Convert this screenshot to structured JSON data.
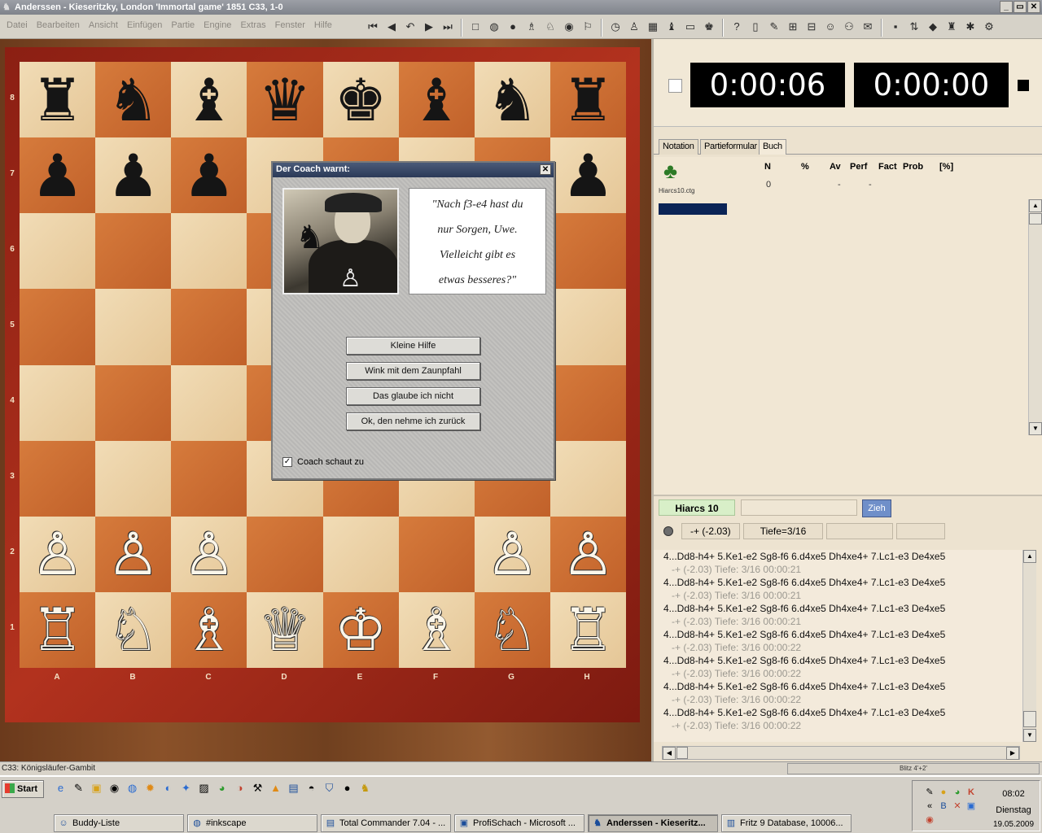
{
  "window": {
    "title": "Anderssen - Kieseritzky, London 'Immortal game' 1851  C33, 1-0",
    "buttons": [
      "_",
      "▭",
      "✕"
    ]
  },
  "menu": [
    "Datei",
    "Bearbeiten",
    "Ansicht",
    "Einfügen",
    "Partie",
    "Engine",
    "Extras",
    "Fenster",
    "Hilfe"
  ],
  "board": {
    "files": [
      "A",
      "B",
      "C",
      "D",
      "E",
      "F",
      "G",
      "H"
    ],
    "ranks": [
      "8",
      "7",
      "6",
      "5",
      "4",
      "3",
      "2",
      "1"
    ],
    "rows": [
      [
        "♜",
        "♞",
        "♝",
        "♛",
        "♚",
        "♝",
        "♞",
        "♜"
      ],
      [
        "♟",
        "♟",
        "♟",
        "",
        "",
        "",
        "",
        "♟"
      ],
      [
        "",
        "",
        "",
        "",
        "",
        "",
        "",
        ""
      ],
      [
        "",
        "",
        "",
        "",
        "",
        "",
        "",
        ""
      ],
      [
        "",
        "",
        "",
        "",
        "",
        "",
        "",
        ""
      ],
      [
        "",
        "",
        "",
        "",
        "",
        "",
        "",
        ""
      ],
      [
        "♙",
        "♙",
        "♙",
        "",
        "",
        "",
        "♙",
        "♙"
      ],
      [
        "♖",
        "♘",
        "♗",
        "♕",
        "♔",
        "♗",
        "♘",
        "♖"
      ]
    ]
  },
  "coach": {
    "title": "Der Coach warnt:",
    "quote_lines": [
      "\"Nach f3-e4 hast du",
      "nur Sorgen, Uwe.",
      "Vielleicht gibt es",
      "etwas besseres?\""
    ],
    "buttons": [
      "Kleine Hilfe",
      "Wink mit dem Zaunpfahl",
      "Das glaube ich nicht",
      "Ok, den nehme ich zurück"
    ],
    "checkbox_label": "Coach schaut zu",
    "checkbox_checked": true
  },
  "clocks": {
    "white": "0:00:06",
    "black": "0:00:00"
  },
  "tabs": [
    "Notation",
    "Partieformular",
    "Buch"
  ],
  "book": {
    "columns": [
      "N",
      "%",
      "Av",
      "Perf",
      "Fact",
      "Prob",
      "[%]"
    ],
    "values": [
      "0",
      "-",
      "-"
    ],
    "file": "Hiarcs10.ctg"
  },
  "engine": {
    "name": "Hiarcs 10",
    "move_button": "Zieh",
    "eval": "-+  (-2.03)",
    "depth": "Tiefe=3/16",
    "lines": [
      {
        "move": "4...Dd8-h4+ 5.Ke1-e2 Sg8-f6 6.d4xe5 Dh4xe4+ 7.Lc1-e3 De4xe5",
        "info": "-+  (-2.03)   Tiefe: 3/16   00:00:21"
      },
      {
        "move": "4...Dd8-h4+ 5.Ke1-e2 Sg8-f6 6.d4xe5 Dh4xe4+ 7.Lc1-e3 De4xe5",
        "info": "-+  (-2.03)   Tiefe: 3/16   00:00:21"
      },
      {
        "move": "4...Dd8-h4+ 5.Ke1-e2 Sg8-f6 6.d4xe5 Dh4xe4+ 7.Lc1-e3 De4xe5",
        "info": "-+  (-2.03)   Tiefe: 3/16   00:00:21"
      },
      {
        "move": "4...Dd8-h4+ 5.Ke1-e2 Sg8-f6 6.d4xe5 Dh4xe4+ 7.Lc1-e3 De4xe5",
        "info": "-+  (-2.03)   Tiefe: 3/16   00:00:22"
      },
      {
        "move": "4...Dd8-h4+ 5.Ke1-e2 Sg8-f6 6.d4xe5 Dh4xe4+ 7.Lc1-e3 De4xe5",
        "info": "-+  (-2.03)   Tiefe: 3/16   00:00:22"
      },
      {
        "move": "4...Dd8-h4+ 5.Ke1-e2 Sg8-f6 6.d4xe5 Dh4xe4+ 7.Lc1-e3 De4xe5",
        "info": "-+  (-2.03)   Tiefe: 3/16   00:00:22"
      },
      {
        "move": "4...Dd8-h4+ 5.Ke1-e2 Sg8-f6 6.d4xe5 Dh4xe4+ 7.Lc1-e3 De4xe5",
        "info": "-+  (-2.03)   Tiefe: 3/16   00:00:22"
      }
    ]
  },
  "status": {
    "left": "C33: Königsläufer-Gambit",
    "right": "Blitz 4'+2'"
  },
  "taskbar": {
    "start": "Start",
    "tasks": [
      {
        "label": "Buddy-Liste",
        "active": false
      },
      {
        "label": "#inkscape",
        "active": false
      },
      {
        "label": "Total Commander 7.04 - ...",
        "active": false
      },
      {
        "label": "ProfiSchach - Microsoft ...",
        "active": false
      },
      {
        "label": "Anderssen - Kieseritz...",
        "active": true
      },
      {
        "label": "Fritz 9 Database,  10006...",
        "active": false
      }
    ],
    "time": "08:02",
    "day": "Dienstag",
    "date": "19.05.2009"
  }
}
